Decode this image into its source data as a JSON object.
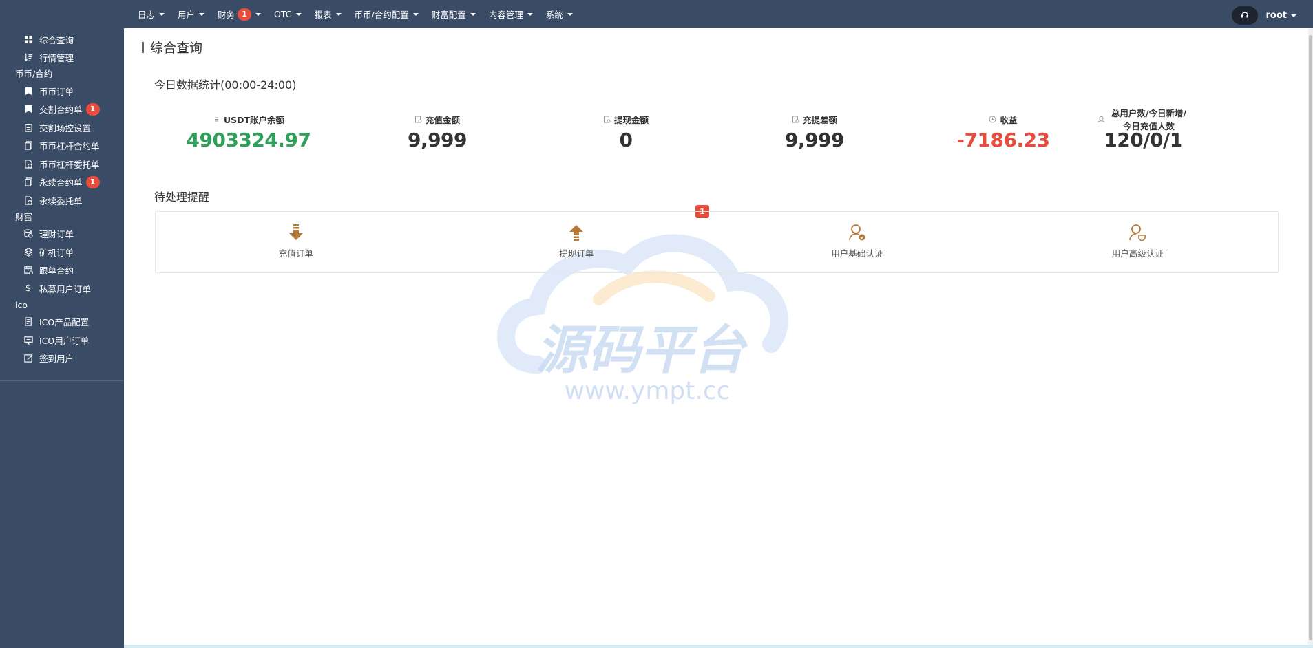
{
  "sidebar": {
    "items_top": [
      {
        "label": "综合查询",
        "icon": "dashboard-icon"
      },
      {
        "label": "行情管理",
        "icon": "sort-icon"
      }
    ],
    "group_coin": "币币/合约",
    "items_coin": [
      {
        "label": "币币订单",
        "icon": "bookmark-icon"
      },
      {
        "label": "交割合约单",
        "icon": "bookmark-icon",
        "badge": "1"
      },
      {
        "label": "交割场控设置",
        "icon": "clipboard-icon"
      },
      {
        "label": "币币杠杆合约单",
        "icon": "copy-icon"
      },
      {
        "label": "币币杠杆委托单",
        "icon": "file-clock-icon"
      },
      {
        "label": "永续合约单",
        "icon": "copy-icon",
        "badge": "1"
      },
      {
        "label": "永续委托单",
        "icon": "file-clock-icon"
      }
    ],
    "group_wealth": "财富",
    "items_wealth": [
      {
        "label": "理财订单",
        "icon": "coins-icon"
      },
      {
        "label": "矿机订单",
        "icon": "layers-icon"
      },
      {
        "label": "跟单合约",
        "icon": "calendar-icon"
      },
      {
        "label": "私募用户订单",
        "icon": "dollar-icon"
      }
    ],
    "group_ico": "ico",
    "items_ico": [
      {
        "label": "ICO产品配置",
        "icon": "edit-doc-icon"
      },
      {
        "label": "ICO用户订单",
        "icon": "monitor-icon"
      },
      {
        "label": "签到用户",
        "icon": "checkin-icon"
      }
    ]
  },
  "topnav": {
    "items": [
      {
        "label": "日志"
      },
      {
        "label": "用户"
      },
      {
        "label": "财务",
        "badge": "1"
      },
      {
        "label": "OTC"
      },
      {
        "label": "报表"
      },
      {
        "label": "币币/合约配置"
      },
      {
        "label": "财富配置"
      },
      {
        "label": "内容管理"
      },
      {
        "label": "系统"
      }
    ],
    "user": "root",
    "support_icon": "headset-icon"
  },
  "main": {
    "page_title": "综合查询",
    "today_title": "今日数据统计(00:00-24:00)",
    "stats": [
      {
        "label": "USDT账户余额",
        "value": "4903324.97",
        "color": "#2fa05a"
      },
      {
        "label": "充值金额",
        "value": "9,999",
        "color": "#333333"
      },
      {
        "label": "提现金额",
        "value": "0",
        "color": "#333333"
      },
      {
        "label": "充提差额",
        "value": "9,999",
        "color": "#333333"
      },
      {
        "label": "收益",
        "value": "-7186.23",
        "color": "#e84c3d"
      },
      {
        "label": "总用户数/今日新增/今日充值人数",
        "value": "120/0/1",
        "color": "#333333"
      }
    ],
    "pending_title": "待处理提醒",
    "pending_badge": "1",
    "pending": [
      {
        "label": "充值订单",
        "icon": "download-arrow-icon"
      },
      {
        "label": "提现订单",
        "icon": "upload-arrow-icon"
      },
      {
        "label": "用户基础认证",
        "icon": "user-check-icon"
      },
      {
        "label": "用户高级认证",
        "icon": "user-shield-icon"
      }
    ],
    "accent_color": "#b57a3a"
  },
  "watermark": {
    "title": "源码平台",
    "url": "www.ympt.cc"
  }
}
